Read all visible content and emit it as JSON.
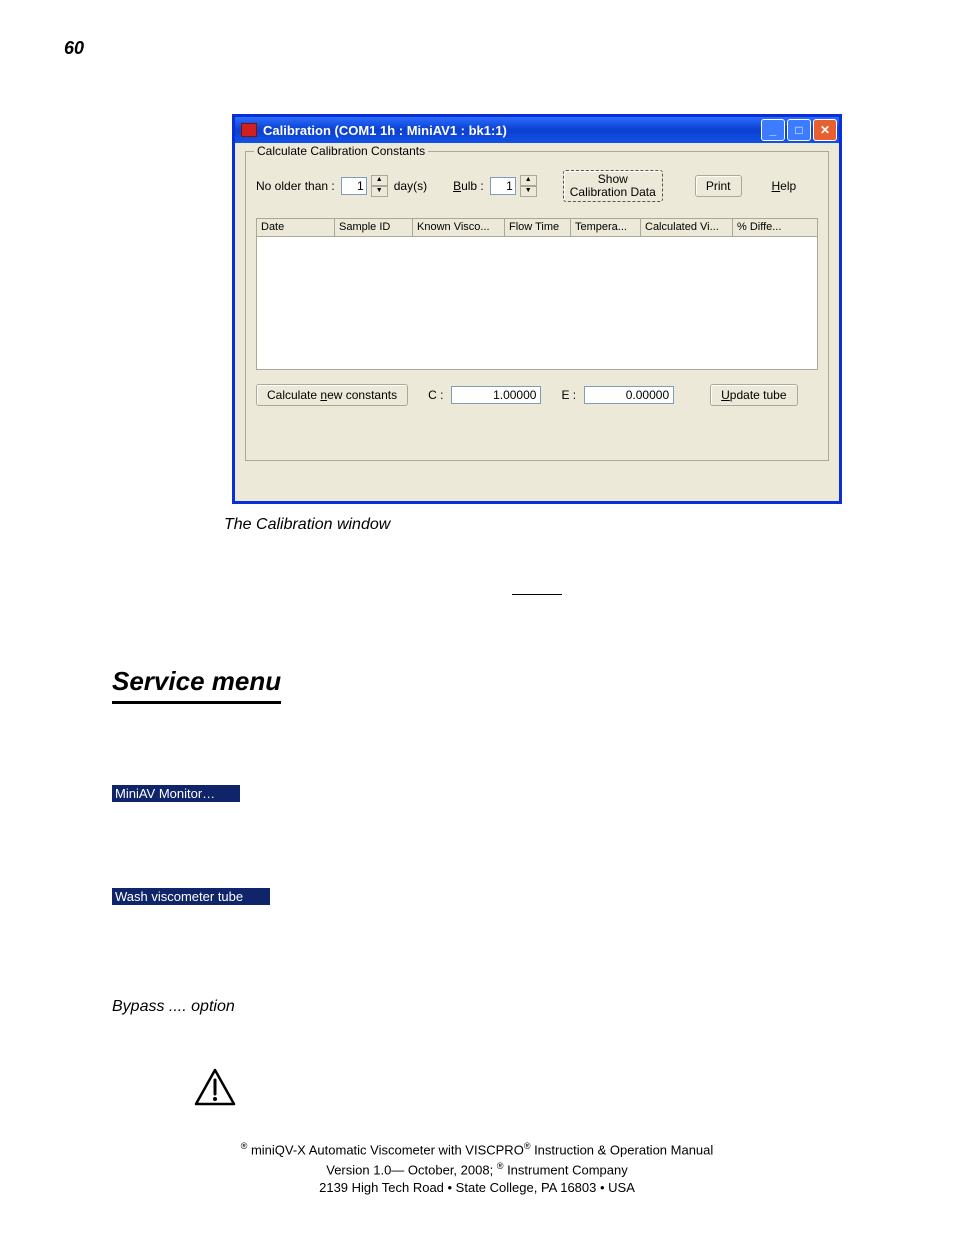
{
  "page_number": "60",
  "window": {
    "title": "Calibration (COM1 1h : MiniAV1 : bk1:1)",
    "groupbox_label": "Calculate Calibration Constants",
    "no_older_label": "No older than :",
    "no_older_value": "1",
    "day_label": "day(s)",
    "bulb_label_prefix": "B",
    "bulb_label_rest": "ulb :",
    "bulb_value": "1",
    "show_btn_line1": "Show",
    "show_btn_line2": "Calibration Data",
    "print_btn": "Print",
    "help_prefix": "H",
    "help_rest": "elp",
    "columns": [
      "Date",
      "Sample ID",
      "Known Visco...",
      "Flow Time",
      "Tempera...",
      "Calculated Vi...",
      "% Diffe..."
    ],
    "calc_btn_pre": "Calculate ",
    "calc_btn_u": "n",
    "calc_btn_post": "ew constants",
    "c_label": "C :",
    "c_value": "1.00000",
    "e_label": "E :",
    "e_value": "0.00000",
    "update_pre": "U",
    "update_post": "pdate tube"
  },
  "caption": "The Calibration window",
  "heading": "Service menu",
  "menu_item_1": "MiniAV Monitor…",
  "menu_item_2": "Wash viscometer tube",
  "subheading": "Bypass .... option",
  "footer": {
    "line1_pre": " miniQV-X Automatic Viscometer with VISCPRO",
    "line1_post": " Instruction & Operation Manual",
    "line2_pre": "Version 1.0— October, 2008;             ",
    "line2_post": " Instrument Company",
    "line3": "2139 High Tech Road • State College, PA  16803 • USA",
    "reg": "®"
  }
}
